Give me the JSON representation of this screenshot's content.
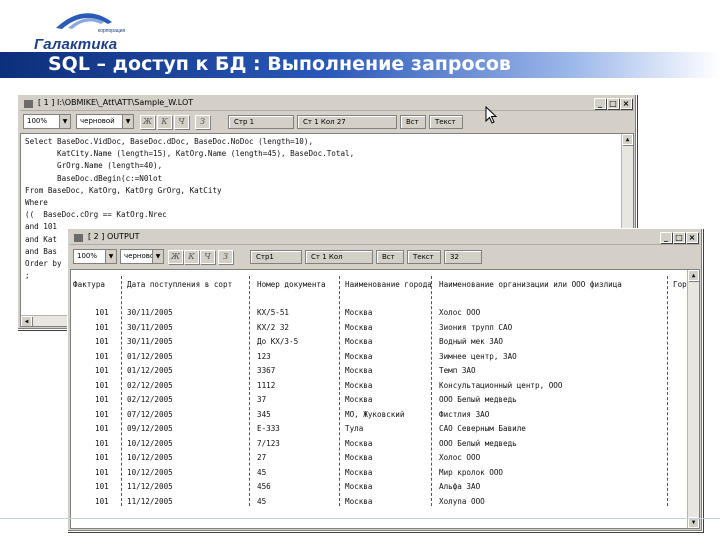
{
  "slide": {
    "logo_sub": "корпорация",
    "logo_name": "Галактика",
    "title": "SQL – доступ к БД : Выполнение запросов"
  },
  "colors": {
    "title_band_start": "#0d2f7a",
    "title_band_end": "#9fb9ea",
    "window_face": "#d4d0c8"
  },
  "window1": {
    "title": "[ 1 ]  I:\\OBMIKE\\_Att\\ATT\\Sample_W.LOT",
    "caption_buttons": [
      "_",
      "□",
      "×"
    ],
    "toolbar": {
      "zoom": "100%",
      "mode": "черновой",
      "format_buttons": [
        "Ж",
        "К",
        "Ч",
        "З"
      ],
      "fields": [
        "Стр 1",
        "Ст 1 Кол 27",
        "Вст",
        "Текст"
      ]
    },
    "sql_lines": [
      "Select BaseDoc.VidDoc, BaseDoc.dDoc, BaseDoc.NoDoc (length=10),",
      "       KatCity.Name (length=15), KatOrg.Name (length=45), BaseDoc.Total,",
      "       GrOrg.Name (length=40),",
      "       BaseDoc.dBegin(c:=N0lot",
      "From BaseDoc, KatOrg, KatOrg GrOrg, KatCity",
      "Where",
      "((  BaseDoc.cOrg == KatOrg.Nrec",
      "and 101",
      "and Kat",
      "and Bas",
      "Order by",
      ";"
    ]
  },
  "window2": {
    "title": "[ 2 ]  OUTPUT",
    "caption_buttons": [
      "_",
      "□",
      "×"
    ],
    "toolbar": {
      "zoom": "100%",
      "mode": "черновой",
      "format_buttons": [
        "Ж",
        "К",
        "Ч",
        "З"
      ],
      "fields": [
        "Стр1",
        "Ст 1 Кол",
        "Вст",
        "Текст",
        "32"
      ]
    },
    "columns": [
      "Фактура",
      "Дата поступления в сорт",
      "Номер документа",
      "Наименование города",
      "Наименование организации или ООО физлица",
      "Гор"
    ],
    "rows": [
      [
        "101",
        "30/11/2005",
        "КХ/5-51",
        "Москва",
        "Холос ООО"
      ],
      [
        "101",
        "30/11/2005",
        "КХ/2 32",
        "Москва",
        "Зиония трупп САО"
      ],
      [
        "101",
        "30/11/2005",
        "До КХ/3-5",
        "Москва",
        "Водный мек ЗАО"
      ],
      [
        "101",
        "01/12/2005",
        "123",
        "Москва",
        "Зимнее центр, ЗАО"
      ],
      [
        "101",
        "01/12/2005",
        "3367",
        "Москва",
        "Темп ЗАО"
      ],
      [
        "101",
        "02/12/2005",
        "1112",
        "Москва",
        "Консультационный центр, ООО"
      ],
      [
        "101",
        "02/12/2005",
        "37",
        "Москва",
        "ООО Белый медведь"
      ],
      [
        "101",
        "07/12/2005",
        "345",
        "МО, Жуковский",
        "Фистлия ЗАО"
      ],
      [
        "101",
        "09/12/2005",
        "Е-333",
        "Тула",
        "САО Северным Бавиле"
      ],
      [
        "101",
        "10/12/2005",
        "7/123",
        "Москва",
        "ООО Белый медведь"
      ],
      [
        "101",
        "10/12/2005",
        "27",
        "Москва",
        "Холос ООО"
      ],
      [
        "101",
        "10/12/2005",
        "45",
        "Москва",
        "Мир кролок ООО"
      ],
      [
        "101",
        "11/12/2005",
        "456",
        "Москва",
        "Альфа ЗАО"
      ],
      [
        "101",
        "11/12/2005",
        "45",
        "Москва",
        "Холупа ООО"
      ]
    ]
  }
}
